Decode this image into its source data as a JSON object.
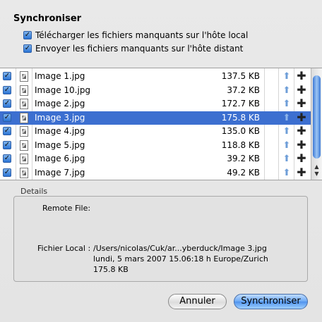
{
  "dialog": {
    "title": "Synchroniser",
    "options": [
      {
        "label": "Télécharger les fichiers manquants sur l'hôte local",
        "checked": true
      },
      {
        "label": "Envoyer les fichiers manquants sur l'hôte distant",
        "checked": true
      }
    ]
  },
  "files": [
    {
      "name": "Image 1.jpg",
      "size": "137.5 KB",
      "checked": true,
      "selected": false
    },
    {
      "name": "Image 10.jpg",
      "size": "37.2 KB",
      "checked": true,
      "selected": false
    },
    {
      "name": "Image 2.jpg",
      "size": "172.7 KB",
      "checked": true,
      "selected": false
    },
    {
      "name": "Image 3.jpg",
      "size": "175.8 KB",
      "checked": true,
      "selected": true
    },
    {
      "name": "Image 4.jpg",
      "size": "135.0 KB",
      "checked": true,
      "selected": false
    },
    {
      "name": "Image 5.jpg",
      "size": "118.8 KB",
      "checked": true,
      "selected": false
    },
    {
      "name": "Image 6.jpg",
      "size": "39.2 KB",
      "checked": true,
      "selected": false
    },
    {
      "name": "Image 7.jpg",
      "size": "49.2 KB",
      "checked": true,
      "selected": false
    }
  ],
  "icons": {
    "file": "jpeg-file-icon",
    "upload": "upload-arrow-icon",
    "add": "plus-icon"
  },
  "details": {
    "section_label": "Details",
    "remote_label": "Remote File:",
    "remote_value": "",
    "local_label": "Fichier Local :",
    "local_path": "/Users/nicolas/Cuk/ar...yberduck/Image 3.jpg",
    "local_date": "lundi, 5 mars 2007 15.06:18 h Europe/Zurich",
    "local_size": "175.8 KB"
  },
  "buttons": {
    "cancel": "Annuler",
    "ok": "Synchroniser"
  },
  "colors": {
    "selection": "#3c6fd0",
    "default_button": "#5a9cf0"
  }
}
